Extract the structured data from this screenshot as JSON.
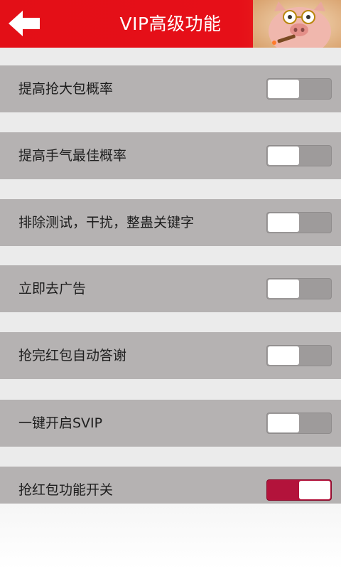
{
  "header": {
    "title": "VIP高级功能",
    "back_icon": "arrow-left-icon",
    "avatar_icon": "pig-avatar-icon",
    "background_color": "#e30f17"
  },
  "settings": [
    {
      "label": "提高抢大包概率",
      "enabled": false
    },
    {
      "label": "提高手气最佳概率",
      "enabled": false
    },
    {
      "label": "排除测试，干扰，整蛊关键字",
      "enabled": false
    },
    {
      "label": "立即去广告",
      "enabled": false
    },
    {
      "label": "抢完红包自动答谢",
      "enabled": false
    },
    {
      "label": "一键开启SVIP",
      "enabled": false
    },
    {
      "label": "抢红包功能开关",
      "enabled": true
    }
  ],
  "colors": {
    "row_background": "#b5b2b2",
    "switch_off": "#9e9b9b",
    "switch_on": "#b3133b"
  }
}
